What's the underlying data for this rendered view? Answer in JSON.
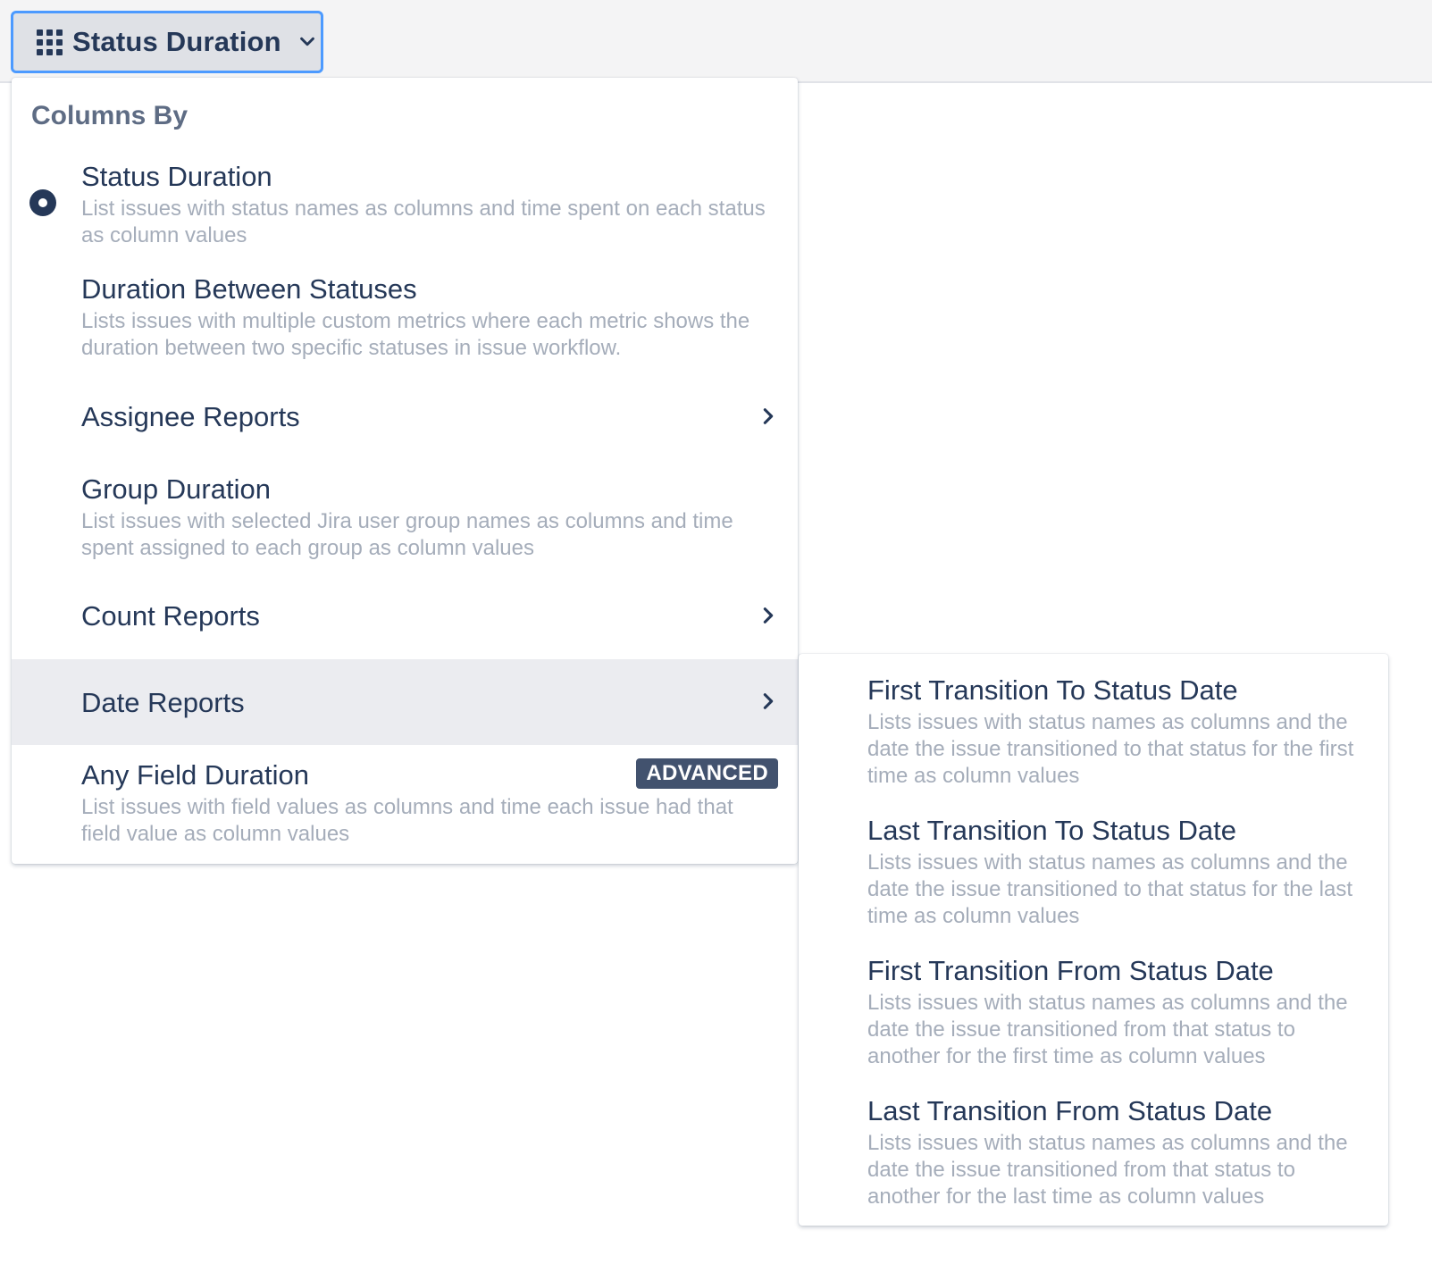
{
  "trigger": {
    "label": "Status Duration",
    "icon": "grid-icon"
  },
  "menu": {
    "heading": "Columns By",
    "items": [
      {
        "title": "Status Duration",
        "description": "List issues with status names as columns and time spent on each status as column values",
        "selected": true
      },
      {
        "title": "Duration Between Statuses",
        "description": "Lists issues with multiple custom metrics where each metric shows the duration between two specific statuses in issue workflow."
      },
      {
        "title": "Assignee Reports",
        "has_submenu": true
      },
      {
        "title": "Group Duration",
        "description": "List issues with selected Jira user group names as columns and time spent assigned to each group as column values"
      },
      {
        "title": "Count Reports",
        "has_submenu": true
      },
      {
        "title": "Date Reports",
        "has_submenu": true,
        "highlighted": true
      },
      {
        "title": "Any Field Duration",
        "description": "List issues with field values as columns and time each issue had that field value as column values",
        "badge": "ADVANCED"
      }
    ]
  },
  "submenu": {
    "items": [
      {
        "title": "First Transition To Status Date",
        "description": "Lists issues with status names as columns and the date the issue transitioned to that status for the first time as column values"
      },
      {
        "title": "Last Transition To Status Date",
        "description": "Lists issues with status names as columns and the date the issue transitioned to that status for the last time as column values"
      },
      {
        "title": "First Transition From Status Date",
        "description": "Lists issues with status names as columns and the date the issue transitioned from that status to another for the first time as column values"
      },
      {
        "title": "Last Transition From Status Date",
        "description": "Lists issues with status names as columns and the date the issue transitioned from that status to another for the last time as column values"
      }
    ]
  },
  "colors": {
    "accent_border": "#4c9aff",
    "text_primary": "#253858",
    "text_secondary": "#a5adba",
    "heading": "#5e6c84",
    "highlight_bg": "#ebecf0",
    "badge_bg": "#42526e"
  }
}
